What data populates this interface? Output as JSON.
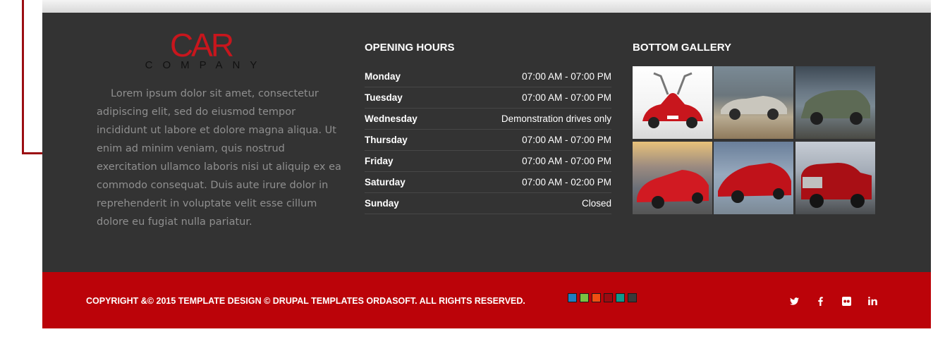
{
  "brand": {
    "logo_main": "CAR",
    "logo_sub": "COMPANY",
    "colors": {
      "brand_red": "#c8161d",
      "bar_red": "#bb0309",
      "footer_bg": "#333333"
    }
  },
  "about": {
    "text": "Lorem ipsum dolor sit amet, consectetur adipiscing elit, sed do eiusmod tempor incididunt ut labore et dolore magna aliqua. Ut enim ad minim veniam, quis nostrud exercitation ullamco laboris nisi ut aliquip ex ea commodo consequat. Duis aute irure dolor in reprehenderit in voluptate velit esse cillum dolore eu fugiat nulla pariatur."
  },
  "opening_hours": {
    "title": "OPENING HOURS",
    "rows": [
      {
        "day": "Monday",
        "hours": "07:00 AM - 07:00 PM"
      },
      {
        "day": "Tuesday",
        "hours": "07:00 AM - 07:00 PM"
      },
      {
        "day": "Wednesday",
        "hours": "Demonstration drives only"
      },
      {
        "day": "Thursday",
        "hours": "07:00 AM - 07:00 PM"
      },
      {
        "day": "Friday",
        "hours": "07:00 AM - 07:00 PM"
      },
      {
        "day": "Saturday",
        "hours": "07:00 AM - 02:00 PM"
      },
      {
        "day": "Sunday",
        "hours": "Closed"
      }
    ]
  },
  "gallery": {
    "title": "BOTTOM GALLERY",
    "images": [
      {
        "icon": "red-gullwing-coupe-photo",
        "body_color": "#c8161d"
      },
      {
        "icon": "silver-convertible-beach-photo",
        "body_color": "#c9c6bd"
      },
      {
        "icon": "green-suv-mountain-photo",
        "body_color": "#5d6a55"
      },
      {
        "icon": "red-muscle-car-sunset-photo",
        "body_color": "#d11a22"
      },
      {
        "icon": "red-sedan-sky-photo",
        "body_color": "#c0121a"
      },
      {
        "icon": "red-pickup-truck-photo",
        "body_color": "#a90f15"
      }
    ]
  },
  "bottom_bar": {
    "copyright": "COPYRIGHT &© 2015 TEMPLATE DESIGN © DRUPAL TEMPLATES ORDASOFT. ALL RIGHTS RESERVED.",
    "color_swatches": [
      "#1f7fc1",
      "#7ac142",
      "#f04e12",
      "#9b0b12",
      "#0f9a8c",
      "#3a3a3a"
    ],
    "social": [
      {
        "icon": "twitter-icon",
        "glyph": "🐦"
      },
      {
        "icon": "facebook-icon",
        "glyph": "f"
      },
      {
        "icon": "flickr-icon",
        "glyph": "●●"
      },
      {
        "icon": "linkedin-icon",
        "glyph": "in"
      }
    ]
  }
}
